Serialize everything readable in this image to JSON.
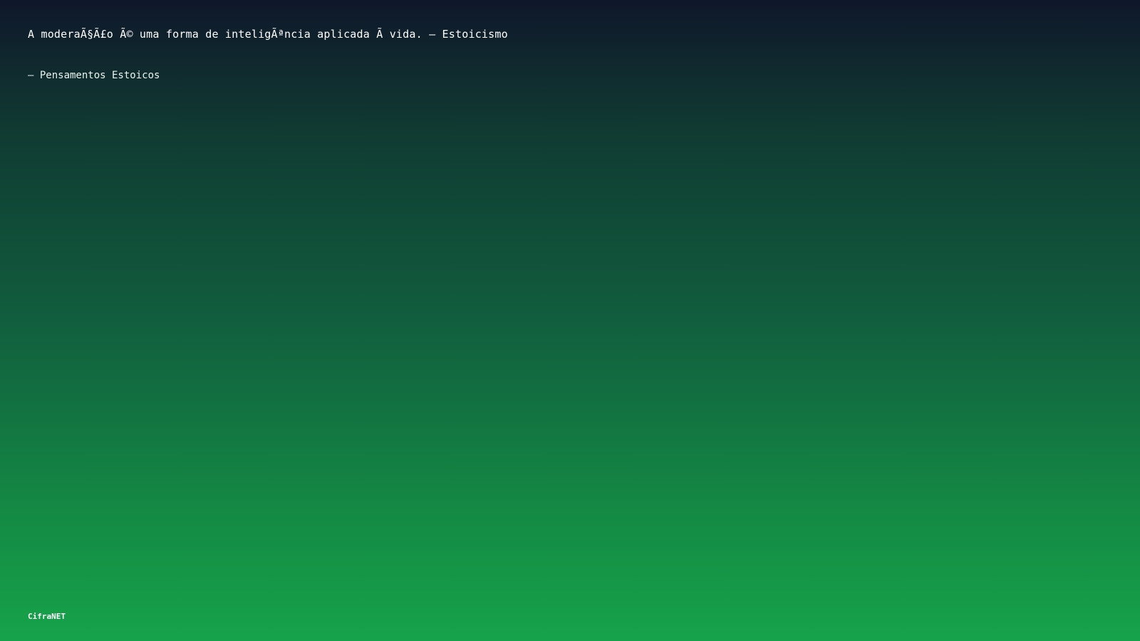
{
  "quote": {
    "text": "A moderaÃ§Ã£o Ã© uma forma de inteligÃªncia aplicada Ã  vida. – Estoicismo",
    "author": "– Pensamentos Estoicos"
  },
  "brand": {
    "name": "CifraNET"
  },
  "colors": {
    "gradient_top": "#0f172a",
    "gradient_bottom": "#16a34a",
    "text": "#ffffff"
  }
}
